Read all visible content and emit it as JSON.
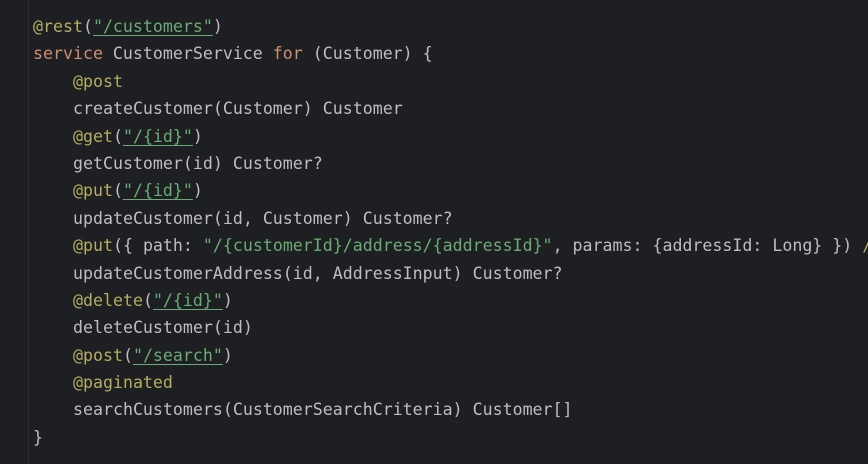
{
  "editor": {
    "colors": {
      "background": "#1e1f22",
      "text": "#bcbec4",
      "annotation": "#b3ae60",
      "keyword": "#cf8e6d",
      "string": "#6aab73"
    },
    "lines": {
      "l1": {
        "ann": "@rest",
        "open": "(",
        "str": "\"/customers\"",
        "close": ")"
      },
      "l2": {
        "kw1": "service",
        "name": " CustomerService ",
        "kw2": "for",
        "rest": " (Customer) {"
      },
      "l3": {
        "ann": "@post"
      },
      "l4": {
        "text": "createCustomer(Customer) Customer"
      },
      "l5": {
        "ann": "@get",
        "open": "(",
        "str": "\"/{id}\"",
        "close": ")"
      },
      "l6": {
        "text": "getCustomer(id) Customer?"
      },
      "l7": {
        "ann": "@put",
        "open": "(",
        "str": "\"/{id}\"",
        "close": ")"
      },
      "l8": {
        "text": "updateCustomer(id, Customer) Customer?"
      },
      "l9": {
        "ann": "@put",
        "open": "({ path: ",
        "str": "\"/{customerId}/address/{addressId}\"",
        "rest": ", params: {addressId: Long} }) ",
        "cut": "/"
      },
      "l10": {
        "text": "updateCustomerAddress(id, AddressInput) Customer?"
      },
      "l11": {
        "ann": "@delete",
        "open": "(",
        "str": "\"/{id}\"",
        "close": ")"
      },
      "l12": {
        "text": "deleteCustomer(id)"
      },
      "l13": {
        "ann": "@post",
        "open": "(",
        "str": "\"/search\"",
        "close": ")"
      },
      "l14": {
        "ann": "@paginated"
      },
      "l15": {
        "text": "searchCustomers(CustomerSearchCriteria) Customer[]"
      },
      "l16": {
        "text": "}"
      }
    }
  }
}
